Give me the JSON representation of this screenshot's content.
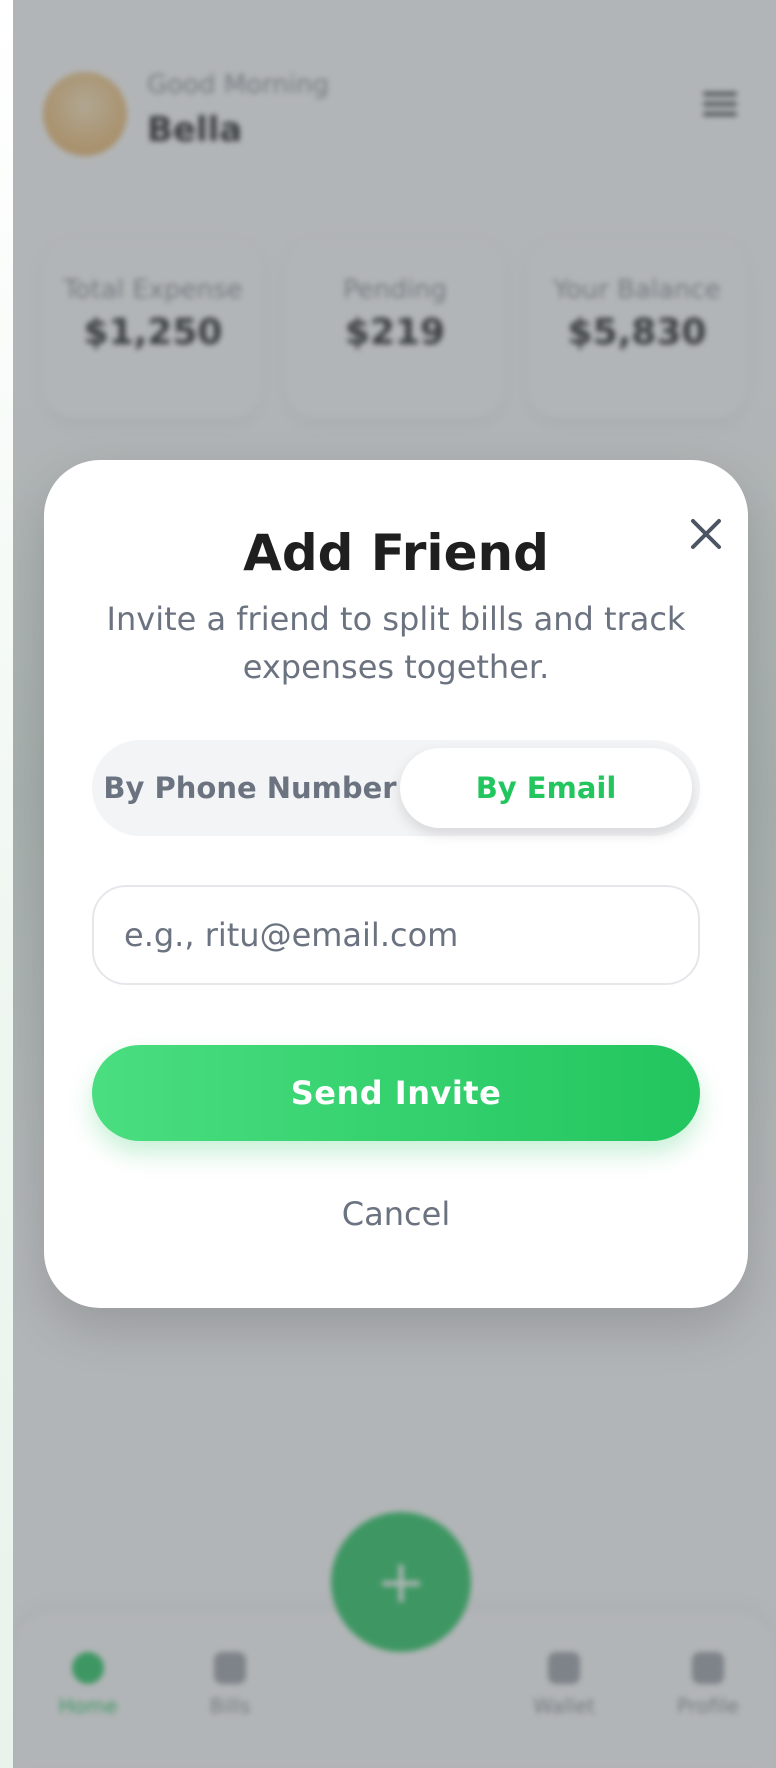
{
  "background": {
    "greeting": "Good Morning",
    "user_name": "Bella",
    "stats": [
      {
        "label": "Total Expense",
        "value": "$1,250"
      },
      {
        "label": "Pending",
        "value": "$219"
      },
      {
        "label": "Your Balance",
        "value": "$5,830"
      }
    ],
    "fab_icon": "+",
    "nav": [
      {
        "label": "Home",
        "icon": "home-icon",
        "active": true
      },
      {
        "label": "Bills",
        "icon": "bills-icon",
        "active": false
      },
      {
        "label": "Wallet",
        "icon": "wallet-icon",
        "active": false
      },
      {
        "label": "Profile",
        "icon": "profile-icon",
        "active": false
      }
    ]
  },
  "modal": {
    "title": "Add Friend",
    "subtitle": "Invite a friend to split bills and track expenses together.",
    "tabs": {
      "phone": "By Phone Number",
      "email": "By Email",
      "selected": "email"
    },
    "input": {
      "placeholder": "e.g., ritu@email.com",
      "value": ""
    },
    "primary_button": "Send Invite",
    "secondary_button": "Cancel",
    "close_icon": "close-icon"
  },
  "colors": {
    "accent": "#22c55e",
    "accent_light": "#4ade80",
    "text_primary": "#1f1f1f",
    "text_muted": "#6b7280",
    "overlay": "#5f6469"
  }
}
